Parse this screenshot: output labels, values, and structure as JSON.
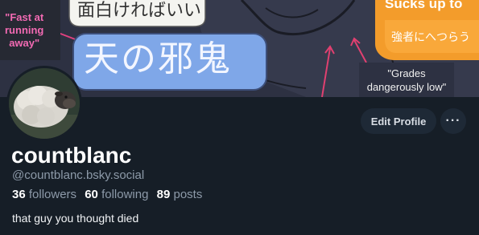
{
  "banner": {
    "pink_label": [
      "\"Fast at",
      "running",
      "away\""
    ],
    "top_kanji": "面白ければいい",
    "big_kanji": "天の邪鬼",
    "sucks_label": "Sucks up to",
    "orange_kanji": "強者にへつらう",
    "grades_label": [
      "\"Grades",
      "dangerously low\""
    ]
  },
  "avatar": {
    "icon": "sheep-avatar"
  },
  "actions": {
    "edit_profile_label": "Edit Profile",
    "more_label": "···"
  },
  "profile": {
    "display_name": "countblanc",
    "handle": "@countblanc.bsky.social",
    "followers_count": "36",
    "followers_label": "followers",
    "following_count": "60",
    "following_label": "following",
    "posts_count": "89",
    "posts_label": "posts",
    "bio": "that guy you thought died"
  },
  "colors": {
    "background": "#161e27",
    "button_bg": "#1e2936",
    "muted_text": "#8d9aa9",
    "banner_pink": "#f26ab3",
    "banner_blue": "#7fa7e8",
    "banner_orange": "#f39c2b"
  }
}
